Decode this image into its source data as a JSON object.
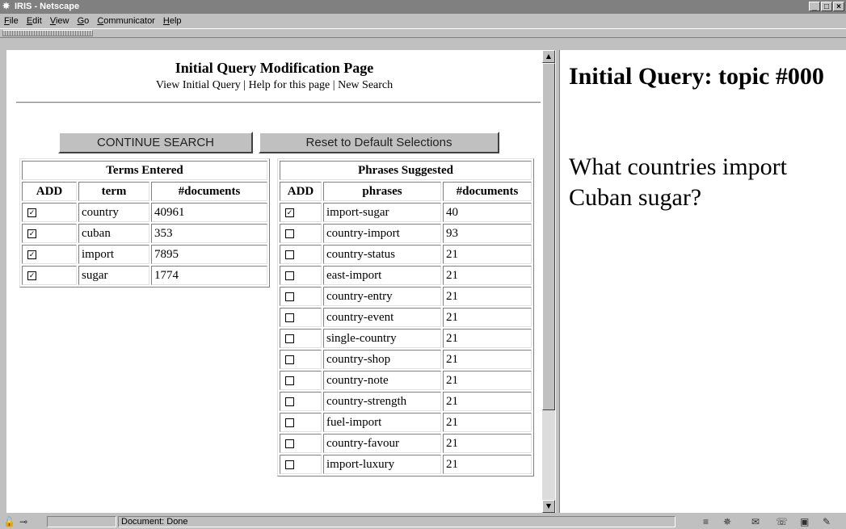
{
  "window": {
    "title": "IRIS - Netscape",
    "app_icon": "netscape-icon",
    "buttons": [
      "_",
      "□",
      "×"
    ]
  },
  "menu": [
    "File",
    "Edit",
    "View",
    "Go",
    "Communicator",
    "Help"
  ],
  "left": {
    "page_title": "Initial Query Modification Page",
    "nav": {
      "view_initial_query": "View Initial Query",
      "sep1": " | ",
      "help": "Help for this page",
      "sep2": " | ",
      "new_search": "New Search"
    },
    "continue_button": "CONTINUE SEARCH",
    "reset_button": "Reset to Default Selections",
    "terms": {
      "caption": "Terms Entered",
      "headers": [
        "ADD",
        "term",
        "#documents"
      ],
      "rows": [
        {
          "checked": true,
          "term": "country",
          "docs": "40961"
        },
        {
          "checked": true,
          "term": "cuban",
          "docs": "353"
        },
        {
          "checked": true,
          "term": "import",
          "docs": "7895"
        },
        {
          "checked": true,
          "term": "sugar",
          "docs": "1774"
        }
      ]
    },
    "phrases": {
      "caption": "Phrases Suggested",
      "headers": [
        "ADD",
        "phrases",
        "#documents"
      ],
      "rows": [
        {
          "checked": true,
          "phrase": "import-sugar",
          "docs": "40"
        },
        {
          "checked": false,
          "phrase": "country-import",
          "docs": "93"
        },
        {
          "checked": false,
          "phrase": "country-status",
          "docs": "21"
        },
        {
          "checked": false,
          "phrase": "east-import",
          "docs": "21"
        },
        {
          "checked": false,
          "phrase": "country-entry",
          "docs": "21"
        },
        {
          "checked": false,
          "phrase": "country-event",
          "docs": "21"
        },
        {
          "checked": false,
          "phrase": "single-country",
          "docs": "21"
        },
        {
          "checked": false,
          "phrase": "country-shop",
          "docs": "21"
        },
        {
          "checked": false,
          "phrase": "country-note",
          "docs": "21"
        },
        {
          "checked": false,
          "phrase": "country-strength",
          "docs": "21"
        },
        {
          "checked": false,
          "phrase": "fuel-import",
          "docs": "21"
        },
        {
          "checked": false,
          "phrase": "country-favour",
          "docs": "21"
        },
        {
          "checked": false,
          "phrase": "import-luxury",
          "docs": "21"
        }
      ]
    }
  },
  "right": {
    "title": "Initial Query: topic #000",
    "query": "What countries import Cuban sugar?"
  },
  "status": {
    "text": "Document: Done"
  }
}
